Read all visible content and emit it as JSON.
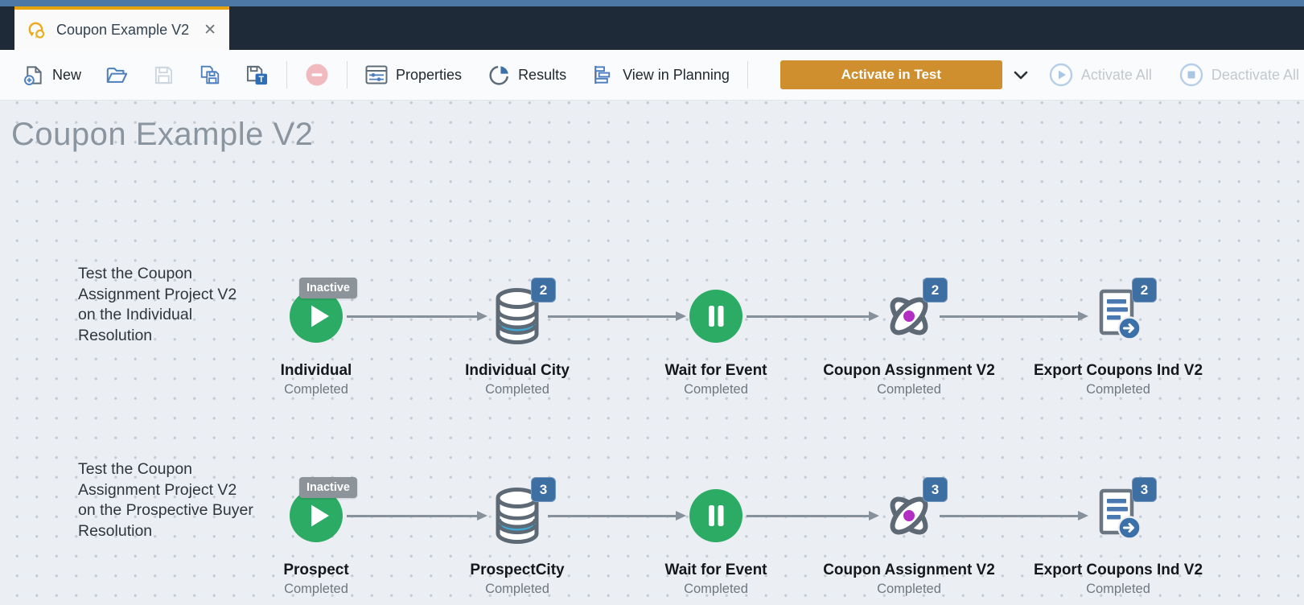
{
  "window": {
    "tab": {
      "title": "Coupon Example V2"
    }
  },
  "toolbar": {
    "new": "New",
    "properties": "Properties",
    "results": "Results",
    "view_in_planning": "View in Planning",
    "activate_in_test": "Activate in Test",
    "activate_all": "Activate All",
    "deactivate_all": "Deactivate All"
  },
  "canvas": {
    "title": "Coupon Example V2",
    "rows": [
      {
        "annotation": "Test the Coupon Assignment Project V2 on the Individual Resolution",
        "nodes": [
          {
            "name": "Individual",
            "status": "Completed",
            "type": "start",
            "tag": "Inactive"
          },
          {
            "name": "Individual City",
            "status": "Completed",
            "type": "data",
            "badge": "2"
          },
          {
            "name": "Wait for Event",
            "status": "Completed",
            "type": "wait"
          },
          {
            "name": "Coupon Assignment V2",
            "status": "Completed",
            "type": "task",
            "badge": "2"
          },
          {
            "name": "Export Coupons Ind V2",
            "status": "Completed",
            "type": "export",
            "badge": "2"
          }
        ]
      },
      {
        "annotation": "Test the Coupon Assignment Project V2 on the Prospective Buyer Resolution",
        "nodes": [
          {
            "name": "Prospect",
            "status": "Completed",
            "type": "start",
            "tag": "Inactive"
          },
          {
            "name": "ProspectCity",
            "status": "Completed",
            "type": "data",
            "badge": "3"
          },
          {
            "name": "Wait for Event",
            "status": "Completed",
            "type": "wait"
          },
          {
            "name": "Coupon Assignment V2",
            "status": "Completed",
            "type": "task",
            "badge": "3"
          },
          {
            "name": "Export Coupons Ind V2",
            "status": "Completed",
            "type": "export",
            "badge": "3"
          }
        ]
      }
    ]
  },
  "colors": {
    "titlebar_blue": "#4d78a6",
    "tabbar_navy": "#1e2a38",
    "accent_gold": "#e5a40c",
    "button_gold": "#cf8f2e",
    "node_green": "#2bab64",
    "badge_blue": "#3e6fa3",
    "inactive_gray": "#8d9499",
    "data_band_blue": "#41a8d2",
    "task_dot_magenta": "#b32fc4",
    "arrow_gray": "#87919b"
  }
}
